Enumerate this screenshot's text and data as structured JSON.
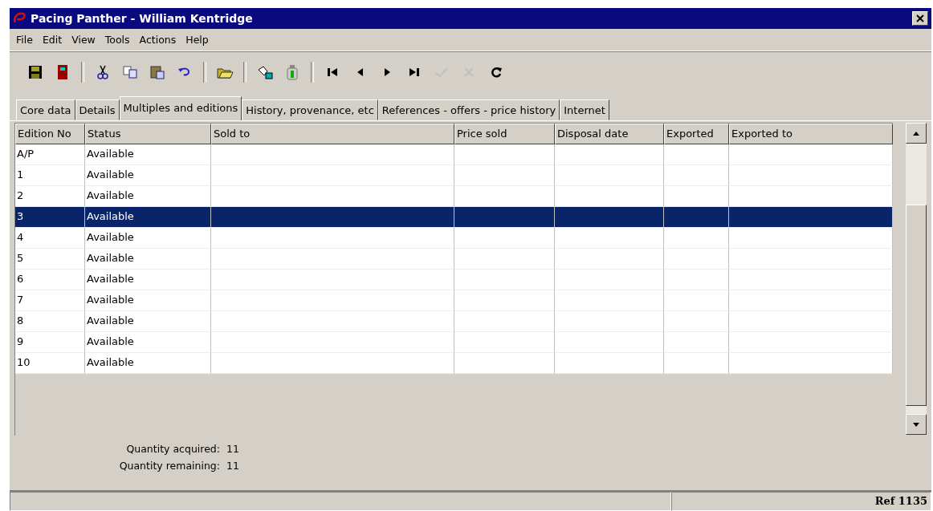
{
  "window": {
    "title": "Pacing Panther - William Kentridge"
  },
  "menu": [
    "File",
    "Edit",
    "View",
    "Tools",
    "Actions",
    "Help"
  ],
  "toolbar": [
    {
      "kind": "save",
      "disabled": false
    },
    {
      "kind": "exit",
      "disabled": false
    },
    {
      "kind": "sep"
    },
    {
      "kind": "cut",
      "disabled": false
    },
    {
      "kind": "copy",
      "disabled": false
    },
    {
      "kind": "paste",
      "disabled": false
    },
    {
      "kind": "undo",
      "disabled": false
    },
    {
      "kind": "sep"
    },
    {
      "kind": "open",
      "disabled": false
    },
    {
      "kind": "sep"
    },
    {
      "kind": "find",
      "disabled": false
    },
    {
      "kind": "bottle",
      "disabled": false
    },
    {
      "kind": "sep"
    },
    {
      "kind": "first",
      "disabled": false
    },
    {
      "kind": "prev",
      "disabled": false
    },
    {
      "kind": "next",
      "disabled": false
    },
    {
      "kind": "last",
      "disabled": false
    },
    {
      "kind": "confirm",
      "disabled": true
    },
    {
      "kind": "cancel",
      "disabled": true
    },
    {
      "kind": "refresh",
      "disabled": false
    }
  ],
  "tabs": [
    {
      "label": "Core data",
      "selected": false
    },
    {
      "label": "Details",
      "selected": false
    },
    {
      "label": "Multiples and editions",
      "selected": true
    },
    {
      "label": "History, provenance, etc",
      "selected": false
    },
    {
      "label": "References - offers - price history",
      "selected": false
    },
    {
      "label": "Internet",
      "selected": false
    }
  ],
  "table": {
    "columns": [
      "Edition No",
      "Status",
      "Sold to",
      "Price sold",
      "Disposal date",
      "Exported",
      "Exported to"
    ],
    "rows": [
      {
        "edition": "A/P",
        "status": "Available",
        "selected": false
      },
      {
        "edition": "1",
        "status": "Available",
        "selected": false
      },
      {
        "edition": "2",
        "status": "Available",
        "selected": false
      },
      {
        "edition": "3",
        "status": "Available",
        "selected": true
      },
      {
        "edition": "4",
        "status": "Available",
        "selected": false
      },
      {
        "edition": "5",
        "status": "Available",
        "selected": false
      },
      {
        "edition": "6",
        "status": "Available",
        "selected": false
      },
      {
        "edition": "7",
        "status": "Available",
        "selected": false
      },
      {
        "edition": "8",
        "status": "Available",
        "selected": false
      },
      {
        "edition": "9",
        "status": "Available",
        "selected": false
      },
      {
        "edition": "10",
        "status": "Available",
        "selected": false
      }
    ]
  },
  "quantities": [
    {
      "label": "Quantity acquired:",
      "value": "11"
    },
    {
      "label": "Quantity remaining:",
      "value": "11"
    }
  ],
  "status_bar": {
    "ref": "Ref 1135"
  }
}
